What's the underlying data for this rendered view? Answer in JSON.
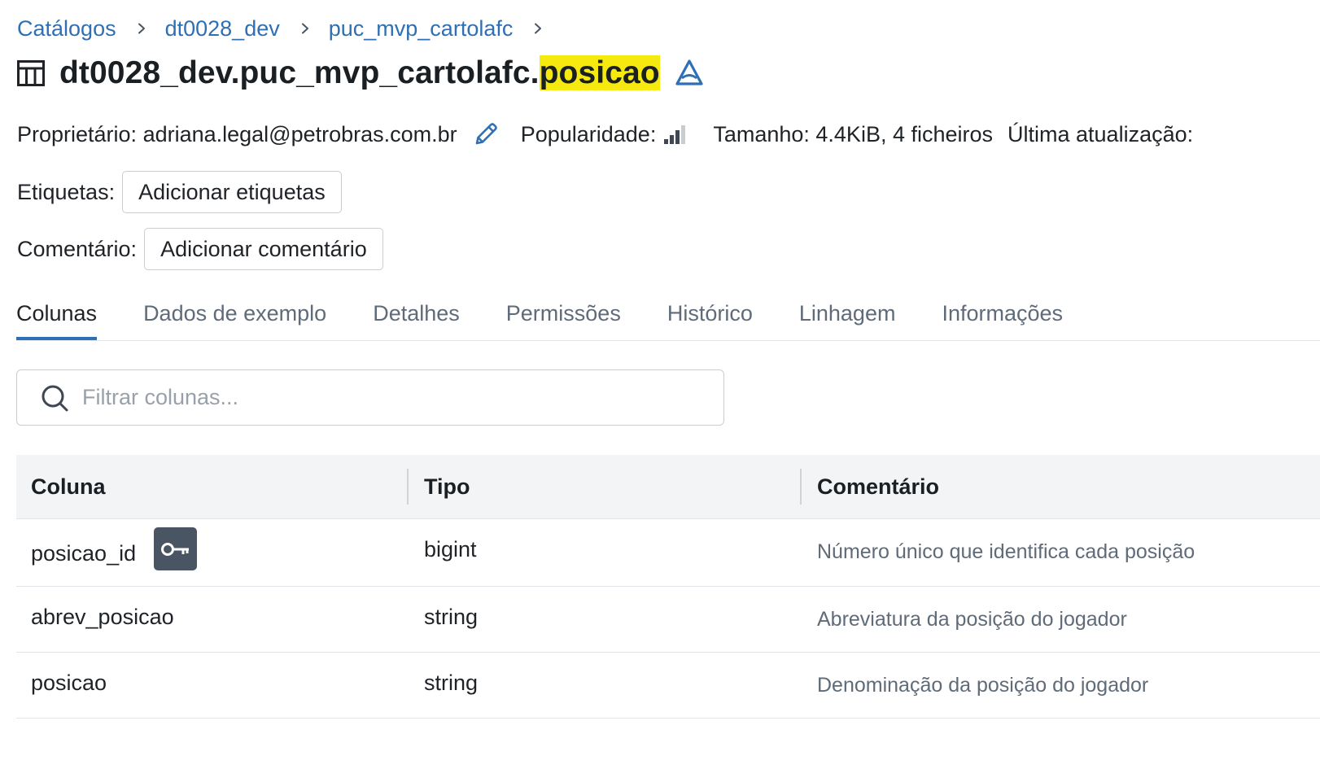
{
  "breadcrumb": [
    {
      "label": "Catálogos"
    },
    {
      "label": "dt0028_dev"
    },
    {
      "label": "puc_mvp_cartolafc"
    }
  ],
  "title": {
    "prefix": "dt0028_dev.puc_mvp_cartolafc.",
    "highlight": "posicao",
    "highlight_color": "#f5e90f"
  },
  "meta": {
    "owner_label": "Proprietário: adriana.legal@petrobras.com.br",
    "popularity_label": "Popularidade:",
    "size_label": "Tamanho: 4.4KiB, 4 ficheiros",
    "updated_label": "Última atualização:"
  },
  "tags": {
    "label": "Etiquetas:",
    "button": "Adicionar etiquetas"
  },
  "comment": {
    "label": "Comentário:",
    "button": "Adicionar comentário"
  },
  "tabs": [
    {
      "label": "Colunas",
      "active": true
    },
    {
      "label": "Dados de exemplo"
    },
    {
      "label": "Detalhes"
    },
    {
      "label": "Permissões"
    },
    {
      "label": "Histórico"
    },
    {
      "label": "Linhagem"
    },
    {
      "label": "Informações"
    }
  ],
  "search": {
    "placeholder": "Filtrar colunas...",
    "value": ""
  },
  "table": {
    "headers": [
      "Coluna",
      "Tipo",
      "Comentário"
    ],
    "rows": [
      {
        "name": "posicao_id",
        "type": "bigint",
        "comment": "Número único que identifica cada posição",
        "primary_key": true
      },
      {
        "name": "abrev_posicao",
        "type": "string",
        "comment": "Abreviatura da posição do jogador"
      },
      {
        "name": "posicao",
        "type": "string",
        "comment": "Denominação da posição do jogador"
      }
    ]
  },
  "icons": {
    "title": "table-icon",
    "delta": "delta-icon",
    "edit": "pencil-icon",
    "popularity": "popularity-bars-icon",
    "search": "search-icon",
    "primary_key": "key-icon",
    "separator": "chevron-right-icon"
  },
  "colors": {
    "link": "#2f6fb3",
    "active_tab_underline": "#2f6fb3",
    "delta_icon": "#2f6fb3",
    "key_badge": "#4a5563",
    "header_bg": "#f3f4f6"
  }
}
